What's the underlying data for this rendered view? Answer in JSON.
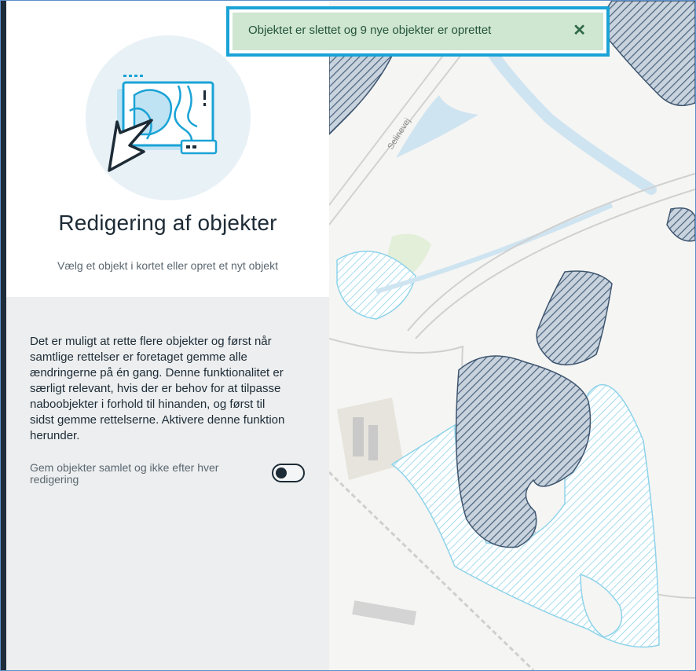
{
  "toast": {
    "message": "Objektet er slettet og 9 nye objekter er oprettet",
    "close_icon": "close-icon"
  },
  "panel": {
    "title": "Redigering af objekter",
    "subtitle": "Vælg et objekt i kortet eller opret et nyt objekt",
    "illustration_icon": "map-cursor-illustration",
    "info_text": "Det er muligt at rette flere objekter og først når samtlige rettelser er foretaget gemme alle ændringerne på én gang. Denne funktionalitet er særligt relevant, hvis der er behov for at tilpasse naboobjekter i forhold til hinanden, og først til sidst gemme rettelserne. Aktivere denne funktion herunder.",
    "toggle_label": "Gem objekter samlet og ikke efter hver redigering",
    "toggle_on": false
  },
  "map": {
    "road_label": "Selinevej"
  },
  "colors": {
    "accent": "#1aa3d6",
    "toast_bg": "#cfe6d1",
    "dark": "#1d2b36"
  }
}
